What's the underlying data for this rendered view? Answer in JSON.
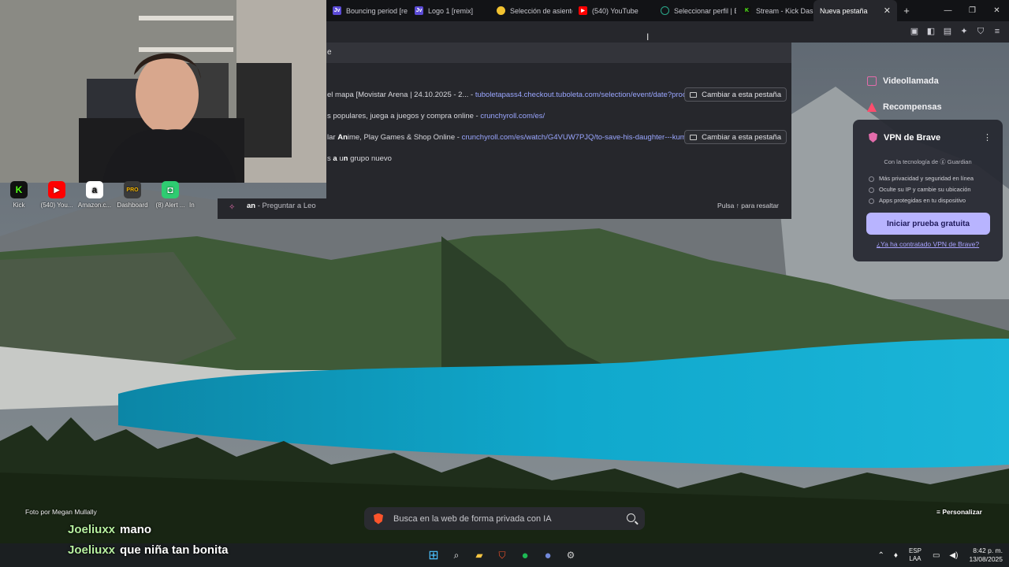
{
  "browser": {
    "tabs": [
      {
        "label": "Bouncing period [re",
        "favicon": "Jv",
        "color": "#5b4bd6"
      },
      {
        "label": "Logo 1 [remix]",
        "favicon": "Jv",
        "color": "#5b4bd6"
      },
      {
        "label": "Selección de asiento",
        "favicon": "",
        "color": "#f2c230"
      },
      {
        "label": "(540) YouTube",
        "favicon": "▶",
        "color": "#ff0000"
      },
      {
        "label": "Seleccionar perfil | E",
        "favicon": "",
        "color": "#2aa98b"
      },
      {
        "label": "Stream - Kick Dashb",
        "favicon": "K",
        "color": "#53fc18"
      }
    ],
    "active_tab": "Nueva pestaña",
    "new_tab_symbol": "+",
    "window_controls": [
      "—",
      "❐",
      "✕"
    ],
    "close_tab_symbol": "✕"
  },
  "omnibox": {
    "input_text": "e",
    "suggestions": [
      {
        "text": "el mapa [Movistar Arena | 24.10.2025 - 2...",
        "url": "tuboletapass4.checkout.tuboleta.com/selection/event/date?prod...",
        "button": "Cambiar a esta pestaña"
      },
      {
        "text": "s populares, juega a juegos y compra online",
        "url": "crunchyroll.com/es/",
        "button": ""
      },
      {
        "text_pre": "lar ",
        "text_bold": "An",
        "text_post": "ime, Play Games & Shop Online",
        "url": "crunchyroll.com/es/watch/G4VUW7PJQ/to-save-his-daughter---kum...",
        "button": "Cambiar a esta pestaña"
      },
      {
        "text_pre": "s ",
        "text_bold": "a",
        "text_mid": " u",
        "text_bold2": "n",
        "text_post": " grupo nuevo"
      }
    ],
    "leo_query": "an",
    "leo_label": "- Preguntar a Leo",
    "leo_hint": "Pulsa ↑ para resaltar"
  },
  "bookmarks": [
    {
      "label": "Kick",
      "icon": "K",
      "color": "#53fc18"
    },
    {
      "label": "(540) You...",
      "icon": "▶",
      "color": "#ff0000"
    },
    {
      "label": "Amazon.c...",
      "icon": "a",
      "color": "#ffffff"
    },
    {
      "label": "Dashboard",
      "icon": "PRO",
      "color": "#3a3a3a"
    },
    {
      "label": "(8) Alert ...",
      "icon": "◘",
      "color": "#2ecc71"
    },
    {
      "label": "In",
      "icon": "",
      "color": "transparent"
    }
  ],
  "brave_panel": {
    "items": [
      "Videollamada",
      "Recompensas"
    ],
    "vpn": {
      "title": "VPN de Brave",
      "tech": "Con la tecnología de ⓖ Guardian",
      "bullets": [
        "Más privacidad y seguridad en línea",
        "Oculte su IP y cambie su ubicación",
        "Apps protegidas en tu dispositivo"
      ],
      "cta": "Iniciar prueba gratuita",
      "link": "¿Ya ha contratado VPN de Brave?"
    }
  },
  "newtab": {
    "photo_credit": "Foto por Megan Mullally",
    "personalize": "Personalizar",
    "search_placeholder": "Busca en la web de forma privada con IA"
  },
  "chat": [
    {
      "user": "Joeliuxx",
      "message": "mano"
    },
    {
      "user": "Joeliuxx",
      "message": "que niña tan bonita"
    }
  ],
  "taskbar": {
    "lang_top": "ESP",
    "lang_bottom": "LAA",
    "time": "8:42 p. m.",
    "date": "13/08/2025"
  }
}
